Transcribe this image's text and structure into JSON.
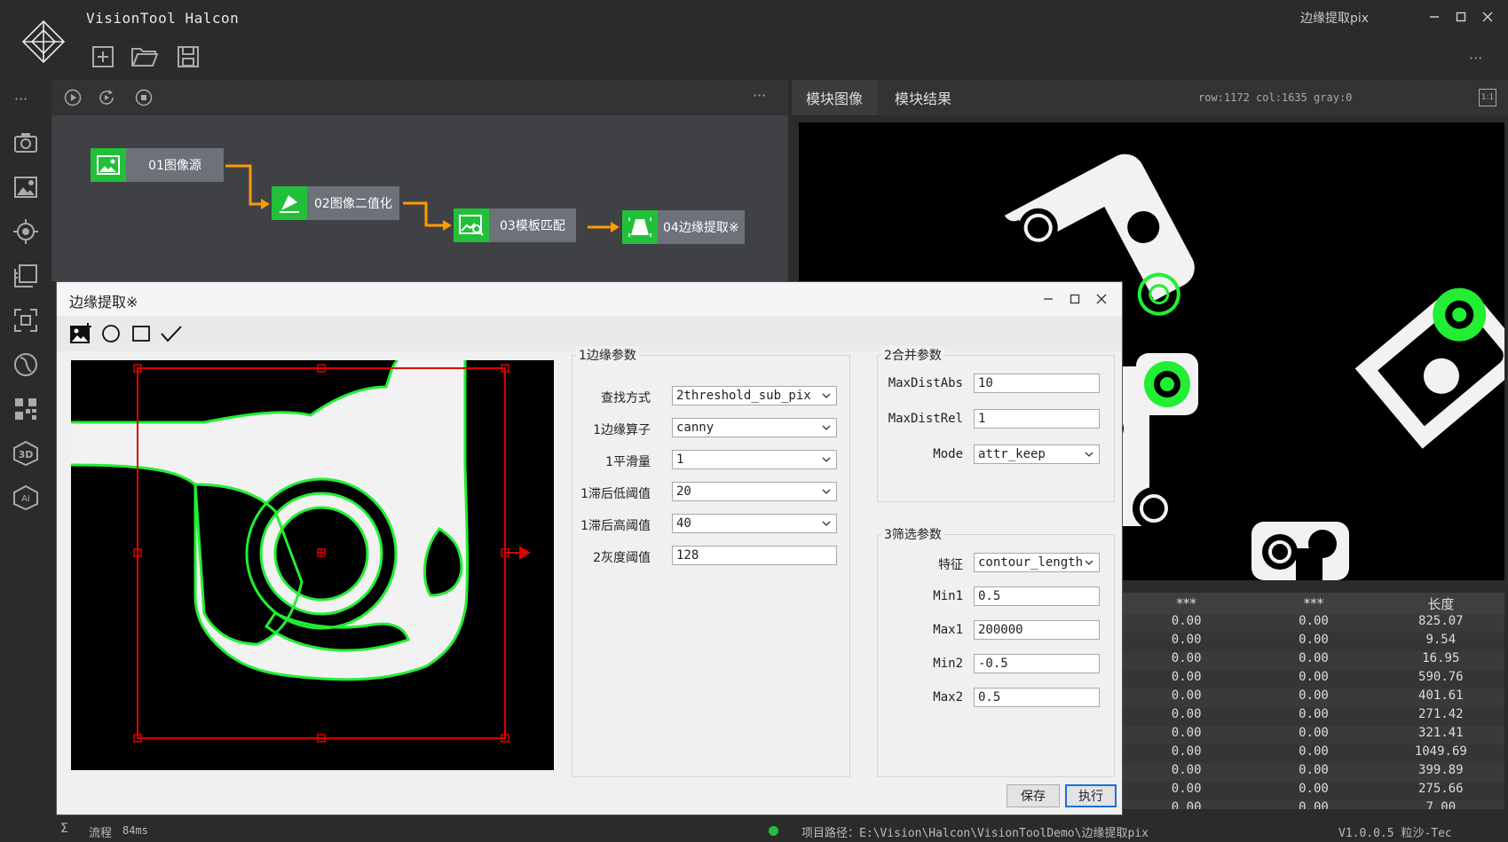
{
  "app": {
    "title": "VisionTool Halcon",
    "window_title": "边缘提取pix",
    "more": "···"
  },
  "flow": {
    "more": "···",
    "nodes": [
      {
        "label": "01图像源"
      },
      {
        "label": "02图像二值化"
      },
      {
        "label": "03模板匹配"
      },
      {
        "label": "04边缘提取※"
      }
    ]
  },
  "image_panel": {
    "tabs": [
      "模块图像",
      "模块结果"
    ],
    "readout": "row:1172 col:1635 gray:0",
    "zoom_label": "1:1"
  },
  "results": {
    "headers": [
      "***",
      "***",
      "长度"
    ],
    "rows": [
      [
        "0.00",
        "0.00",
        "825.07"
      ],
      [
        "0.00",
        "0.00",
        "9.54"
      ],
      [
        "0.00",
        "0.00",
        "16.95"
      ],
      [
        "0.00",
        "0.00",
        "590.76"
      ],
      [
        "0.00",
        "0.00",
        "401.61"
      ],
      [
        "0.00",
        "0.00",
        "271.42"
      ],
      [
        "0.00",
        "0.00",
        "321.41"
      ],
      [
        "0.00",
        "0.00",
        "1049.69"
      ],
      [
        "0.00",
        "0.00",
        "399.89"
      ],
      [
        "0.00",
        "0.00",
        "275.66"
      ],
      [
        "0.00",
        "0.00",
        "7.00"
      ]
    ]
  },
  "status": {
    "flow_label": "流程",
    "flow_time": "84ms",
    "project_path": "项目路径：E:\\Vision\\Halcon\\VisionToolDemo\\边缘提取pix",
    "version": "V1.0.0.5 粒沙-Tec",
    "status_color": "#22c03a"
  },
  "dialog": {
    "title": "边缘提取※",
    "group1": {
      "title": "1边缘参数",
      "fields": [
        {
          "label": "查找方式",
          "value": "2threshold_sub_pix",
          "type": "combo"
        },
        {
          "label": "1边缘算子",
          "value": "canny",
          "type": "combo"
        },
        {
          "label": "1平滑量",
          "value": "1",
          "type": "combo"
        },
        {
          "label": "1滞后低阈值",
          "value": "20",
          "type": "combo"
        },
        {
          "label": "1滞后高阈值",
          "value": "40",
          "type": "combo"
        },
        {
          "label": "2灰度阈值",
          "value": "128",
          "type": "text"
        }
      ]
    },
    "group2": {
      "title": "2合并参数",
      "fields": [
        {
          "label": "MaxDistAbs",
          "value": "10",
          "type": "text"
        },
        {
          "label": "MaxDistRel",
          "value": "1",
          "type": "text"
        },
        {
          "label": "Mode",
          "value": "attr_keep",
          "type": "combo"
        }
      ]
    },
    "group3": {
      "title": "3筛选参数",
      "fields": [
        {
          "label": "特征",
          "value": "contour_length",
          "type": "combo"
        },
        {
          "label": "Min1",
          "value": "0.5",
          "type": "text"
        },
        {
          "label": "Max1",
          "value": "200000",
          "type": "text"
        },
        {
          "label": "Min2",
          "value": "-0.5",
          "type": "text"
        },
        {
          "label": "Max2",
          "value": "0.5",
          "type": "text"
        }
      ]
    },
    "save_label": "保存",
    "run_label": "执行"
  },
  "colors": {
    "accent_green": "#22c03a",
    "roi_red": "#e00000",
    "edge_green": "#22ee33",
    "node_gray": "#6d7179",
    "link_orange": "#ff9a00"
  }
}
